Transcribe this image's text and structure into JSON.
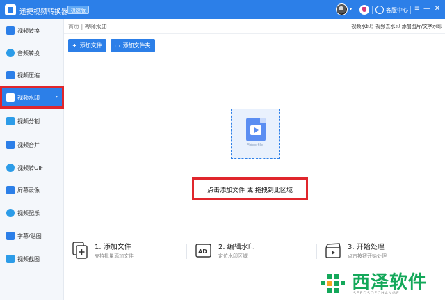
{
  "titlebar": {
    "title": "迅捷视频转换器",
    "badge": "极速版",
    "service_label": "客服中心",
    "icons": {
      "logo": "app-logo-icon",
      "avatar": "user-avatar",
      "vip": "vip-shield-icon",
      "service": "headset-icon",
      "menu": "menu-icon",
      "minimize": "minimize-icon",
      "close": "close-icon"
    },
    "menu_glyph": "≡",
    "minimize_glyph": "—",
    "close_glyph": "✕",
    "caret_glyph": "▾"
  },
  "sidebar": {
    "items": [
      {
        "label": "视频转换",
        "icon": "video-convert-icon",
        "color": "#2c7fe8"
      },
      {
        "label": "音频转换",
        "icon": "audio-convert-icon",
        "color": "#2c9ce8"
      },
      {
        "label": "视频压缩",
        "icon": "video-compress-icon",
        "color": "#2c7fe8"
      },
      {
        "label": "视频水印",
        "icon": "video-watermark-icon",
        "color": "#ffffff",
        "active": true
      },
      {
        "label": "视频分割",
        "icon": "video-split-icon",
        "color": "#2c9ce8"
      },
      {
        "label": "视频合并",
        "icon": "video-merge-icon",
        "color": "#2c7fe8"
      },
      {
        "label": "视频转GIF",
        "icon": "video-to-gif-icon",
        "color": "#2c9ce8"
      },
      {
        "label": "屏幕录像",
        "icon": "screen-record-icon",
        "color": "#2c7fe8"
      },
      {
        "label": "视频配乐",
        "icon": "video-music-icon",
        "color": "#2c9ce8"
      },
      {
        "label": "字幕/贴图",
        "icon": "subtitle-sticker-icon",
        "color": "#2c7fe8"
      },
      {
        "label": "视频截图",
        "icon": "video-screenshot-icon",
        "color": "#2c9ce8"
      }
    ],
    "active_arrow": "▸"
  },
  "main": {
    "breadcrumb": {
      "home": "首页",
      "separator": " | ",
      "current": "视频水印"
    },
    "hint": "视频水印：视频去水印 添加图片/文字水印",
    "buttons": {
      "add_file": "添加文件",
      "add_folder": "添加文件夹",
      "add_file_glyph": "+",
      "add_folder_glyph": "▭"
    },
    "dropzone": {
      "file_caption": "Video file",
      "prompt": "点击添加文件 或 拖拽到此区域"
    },
    "steps": [
      {
        "title": "1. 添加文件",
        "desc": "支持批量添加文件",
        "icon": "add-file-icon"
      },
      {
        "title": "2. 编辑水印",
        "desc": "定位水印区域",
        "icon": "ad-edit-icon"
      },
      {
        "title": "3. 开始处理",
        "desc": "点击按钮开始处理",
        "icon": "clapperboard-icon"
      }
    ]
  },
  "watermark": {
    "text": "西泽软件",
    "sub": "SEEDSOFCHANGE",
    "color": "#14a85a"
  },
  "colors": {
    "accent": "#2c7fe8",
    "highlight_border": "#e0262c"
  }
}
